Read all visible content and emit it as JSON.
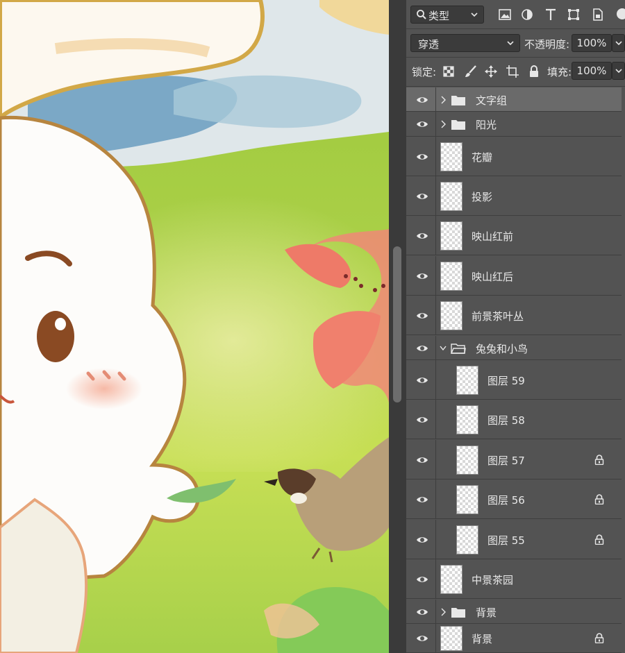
{
  "filter_bar": {
    "filter_type": "类型"
  },
  "blend_bar": {
    "blend_mode": "穿透",
    "opacity_label": "不透明度:",
    "opacity_value": "100%"
  },
  "lock_bar": {
    "lock_label": "锁定:",
    "fill_label": "填充:",
    "fill_value": "100%"
  },
  "layers": [
    {
      "name": "文字组",
      "kind": "group",
      "expanded": false,
      "selected": true
    },
    {
      "name": "阳光",
      "kind": "group",
      "expanded": false
    },
    {
      "name": "花瓣",
      "kind": "layer"
    },
    {
      "name": "投影",
      "kind": "layer"
    },
    {
      "name": "映山红前",
      "kind": "layer"
    },
    {
      "name": "映山红后",
      "kind": "layer"
    },
    {
      "name": "前景茶叶丛",
      "kind": "layer"
    },
    {
      "name": "兔兔和小鸟",
      "kind": "group",
      "expanded": true
    },
    {
      "name": "图层 59",
      "kind": "layer",
      "indent": true
    },
    {
      "name": "图层 58",
      "kind": "layer",
      "indent": true
    },
    {
      "name": "图层 57",
      "kind": "layer",
      "indent": true,
      "locked": true
    },
    {
      "name": "图层 56",
      "kind": "layer",
      "indent": true,
      "locked": true
    },
    {
      "name": "图层 55",
      "kind": "layer",
      "indent": true,
      "locked": true
    },
    {
      "name": "中景茶园",
      "kind": "layer"
    },
    {
      "name": "背景",
      "kind": "group",
      "expanded": false
    },
    {
      "name": "背景",
      "kind": "layer",
      "locked": true
    }
  ],
  "icons": [
    "search-icon",
    "image-filter-icon",
    "adjustment-filter-icon",
    "type-filter-icon",
    "shape-filter-icon",
    "smart-object-filter-icon",
    "eye-icon",
    "folder-icon",
    "lock-icon",
    "chevron-down-icon",
    "chevron-right-icon",
    "brush-lock-icon",
    "move-lock-icon",
    "artboard-lock-icon",
    "checker-lock-icon"
  ],
  "colors": {
    "panel_bg": "#535353",
    "selected_row": "#6a6a6a",
    "field_bg": "#3b3b3b"
  }
}
